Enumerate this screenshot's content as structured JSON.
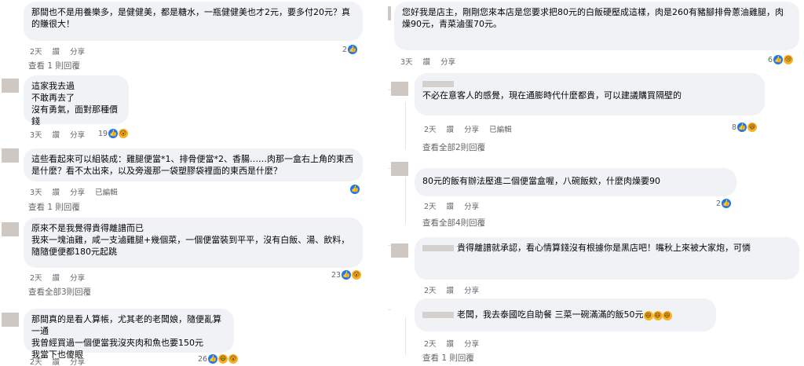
{
  "left": [
    {
      "text": "那間也不是用養樂多，是健健美，都是糖水，一瓶健健美也才2元，要多付20元？真的賺很大！",
      "time": "2天",
      "like": "讚",
      "reply": "分享",
      "reactions": "2",
      "view": "查看 1 則回覆"
    },
    {
      "text": "這家我去過\n不敢再去了\n沒有勇氣，面對那種價錢",
      "time": "3天",
      "like": "讚",
      "reply": "分享",
      "reactions": "19"
    },
    {
      "text": "這些看起來可以組裝成：雞腿便當*1、排骨便當*2、香腸……肉那一盒右上角的東西是什麼？看不太出來，以及旁邊那一袋塑膠袋裡面的東西是什麼？",
      "time": "3天",
      "like": "讚",
      "reply": "分享",
      "edited": "已編輯",
      "view": "查看 1 則回覆"
    },
    {
      "text": "原來不是我覺得貴得離譜而已\n我來一塊油雞，咸一支滷雞腿+幾個菜，一個便當裝到平平，沒有白飯、湯、飲料，隨隨便便都180元起跳",
      "time": "2天",
      "like": "讚",
      "reply": "分享",
      "reactions": "23",
      "view": "查看全部3則回覆"
    },
    {
      "text": "那間真的是看人算帳，尤其老的老闆娘，隨便亂算一通\n我曾經買過一個便當我沒夾肉和魚也要150元\n我當下也傻眼",
      "time": "2天",
      "like": "讚",
      "reply": "分享",
      "reactions": "26"
    }
  ],
  "right": [
    {
      "text": "您好我是店主，剛剛您來本店是您要求把80元的白飯硬壓成這樣，肉是260有豬腳排骨蔥油雞腿，肉燥90元，青菜滷蛋70元。",
      "time": "3天",
      "like": "讚",
      "reply": "分享",
      "reactions": "6"
    },
    {
      "text": "不必在意客人的感覺，現在通膨時代什麼都貴，可以建議購買隔壁的",
      "time": "2天",
      "like": "讚",
      "reply": "分享",
      "edited": "已編輯",
      "reactions": "8",
      "view": "查看全部2則回覆"
    },
    {
      "text": "80元的飯有辦法壓進二個便當盒喔，八碗飯欸，什麼肉燥要90",
      "time": "2天",
      "like": "讚",
      "reply": "分享",
      "reactions": "2",
      "view": "查看全部4則回覆"
    },
    {
      "text": "貴得離譜就承認，看心情算錢沒有根據你是黑店吧！嘴秋上來被大家炮，可憐",
      "time": "2天",
      "like": "讚",
      "reply": "分享"
    },
    {
      "text": "老闆，我去泰國吃自助餐 三菜一碗滿滿的飯50元",
      "time": "2天",
      "like": "讚",
      "reply": "分享",
      "view": "查看 1 則回覆"
    }
  ],
  "icons": {
    "like": "like-icon",
    "haha": "haha-icon",
    "wow": "wow-icon",
    "sad": "sad-icon"
  },
  "colors": {
    "bubble": "#f0f2f5",
    "meta": "#65676b",
    "like": "#1877f2"
  }
}
